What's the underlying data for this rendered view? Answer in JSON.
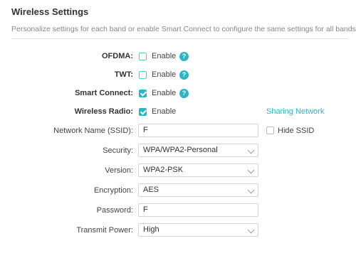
{
  "header": {
    "title": "Wireless Settings",
    "description": "Personalize settings for each band or enable Smart Connect to configure the same settings for all bands."
  },
  "ofdma": {
    "label": "OFDMA:",
    "option_label": "Enable",
    "checked": false,
    "help_icon": "help-circle-icon"
  },
  "twt": {
    "label": "TWT:",
    "option_label": "Enable",
    "checked": false,
    "help_icon": "help-circle-icon"
  },
  "smart_connect": {
    "label": "Smart Connect:",
    "option_label": "Enable",
    "checked": true,
    "help_icon": "help-circle-icon"
  },
  "wireless_radio": {
    "label": "Wireless Radio:",
    "option_label": "Enable",
    "checked": true,
    "link": "Sharing Network"
  },
  "ssid": {
    "label": "Network Name (SSID):",
    "value": "F",
    "hide_label": "Hide SSID",
    "hide_checked": false
  },
  "security": {
    "label": "Security:",
    "value": "WPA/WPA2-Personal"
  },
  "version": {
    "label": "Version:",
    "value": "WPA2-PSK"
  },
  "encryption": {
    "label": "Encryption:",
    "value": "AES"
  },
  "password": {
    "label": "Password:",
    "value": "F"
  },
  "transmit_power": {
    "label": "Transmit Power:",
    "value": "High"
  },
  "colors": {
    "accent": "#2fb4c5",
    "text": "#333333",
    "muted": "#888888"
  }
}
